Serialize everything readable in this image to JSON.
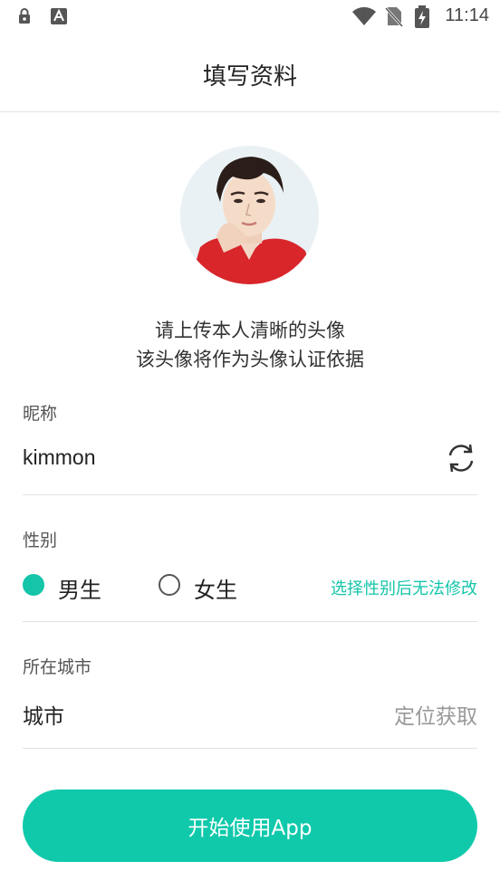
{
  "status_bar": {
    "time": "11:14",
    "icons": [
      "lock-notification-icon",
      "font-a-icon",
      "wifi-icon",
      "no-sim-icon",
      "battery-charging-icon"
    ]
  },
  "header": {
    "title": "填写资料"
  },
  "avatar": {
    "alt": "avatar"
  },
  "hint": {
    "line1": "请上传本人清晰的头像",
    "line2": "该头像将作为头像认证依据"
  },
  "nickname": {
    "label": "昵称",
    "value": "kimmon",
    "refresh_icon": "refresh-icon"
  },
  "gender": {
    "label": "性别",
    "options": [
      {
        "label": "男生",
        "selected": true
      },
      {
        "label": "女生",
        "selected": false
      }
    ],
    "note": "选择性别后无法修改"
  },
  "city": {
    "section_label": "所在城市",
    "field_label": "城市",
    "action": "定位获取"
  },
  "start_button": {
    "label": "开始使用App"
  },
  "colors": {
    "accent": "#10c9ab",
    "divider": "#e2e2e2"
  }
}
